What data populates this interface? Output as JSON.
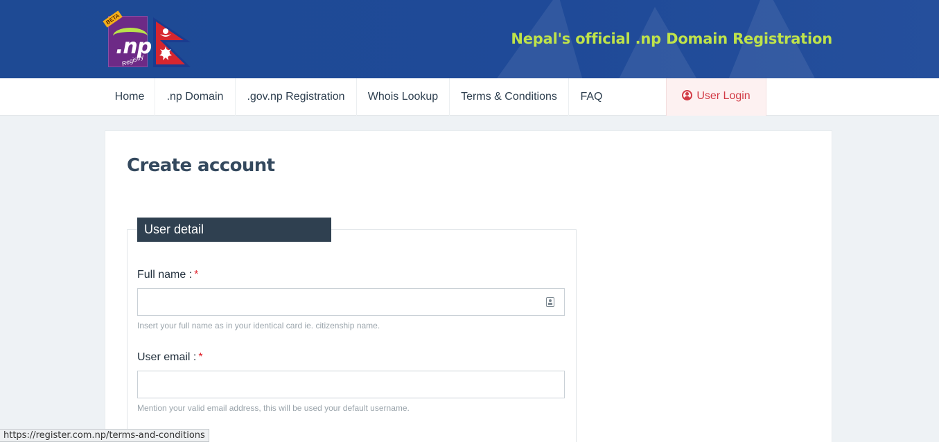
{
  "header": {
    "tagline": "Nepal's official .np Domain Registration",
    "logo": {
      "text": ".np",
      "sub": "Registry",
      "badge": "BETA"
    },
    "colors": {
      "bg": "#1f4a98",
      "tagline": "#bfe34a"
    }
  },
  "nav": {
    "items": [
      {
        "label": "Home"
      },
      {
        "label": ".np Domain"
      },
      {
        "label": ".gov.np Registration"
      },
      {
        "label": "Whois Lookup"
      },
      {
        "label": "Terms & Conditions"
      },
      {
        "label": "FAQ"
      }
    ],
    "login": {
      "label": "User Login",
      "icon": "user-circle-icon"
    }
  },
  "page": {
    "title": "Create account",
    "section": "User detail",
    "fields": [
      {
        "label": "Full name :",
        "required": "*",
        "value": "",
        "help": "Insert your full name as in your identical card ie. citizenship name.",
        "icon": "contact-card-icon"
      },
      {
        "label": "User email :",
        "required": "*",
        "value": "",
        "help": "Mention your valid email address, this will be used your default username."
      }
    ]
  },
  "status_bar": {
    "url": "https://register.com.np/terms-and-conditions"
  }
}
